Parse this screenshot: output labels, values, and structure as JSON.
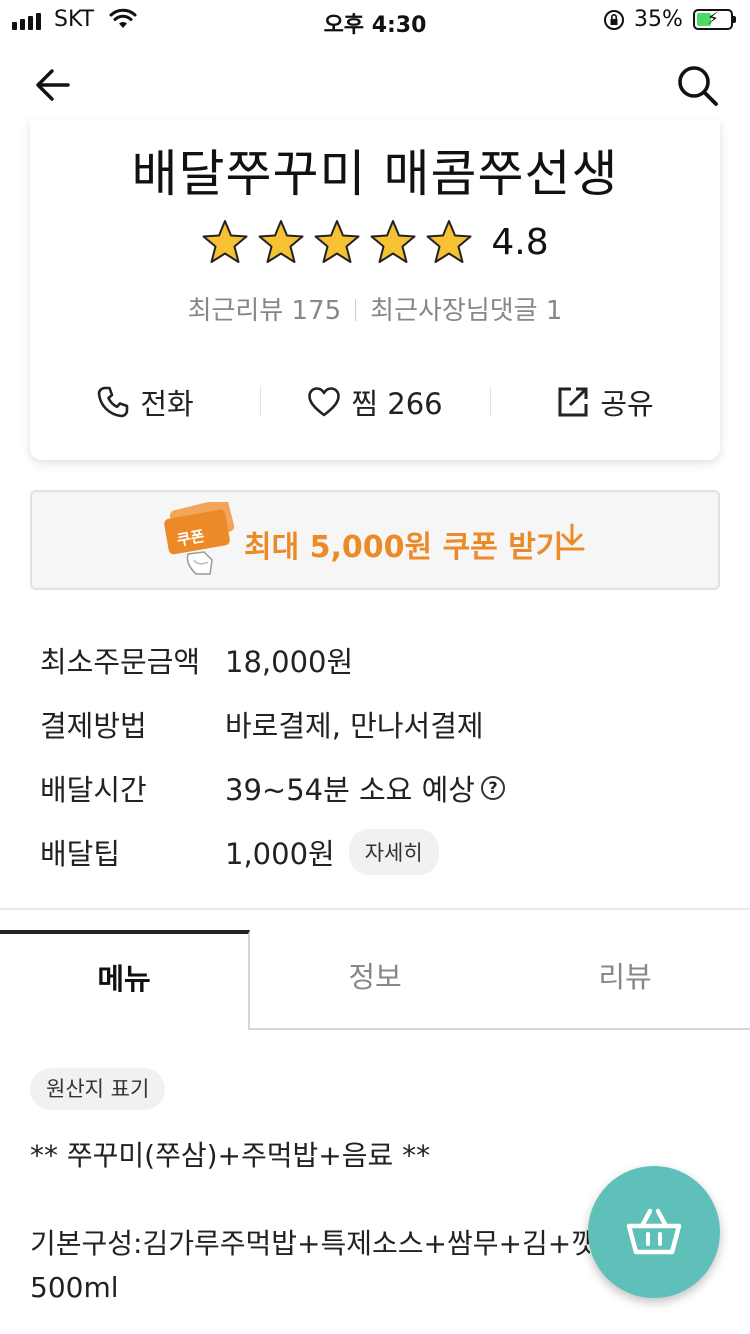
{
  "status_bar": {
    "carrier": "SKT",
    "time": "오후 4:30",
    "battery_percent": "35%",
    "battery_level": 0.35
  },
  "nav": {
    "back_icon": "arrow-left-icon",
    "search_icon": "search-icon"
  },
  "store": {
    "name": "배달쭈꾸미 매콤쭈선생",
    "rating": "4.8",
    "stars": 5,
    "recent_reviews": "최근리뷰 175",
    "owner_comments": "최근사장님댓글 1",
    "actions": {
      "call_label": "전화",
      "favorite_label": "찜 266",
      "share_label": "공유"
    }
  },
  "coupon": {
    "label": "최대 5,000원 쿠폰 받기",
    "ticket_text": "쿠폰",
    "accent": "#ed8a28"
  },
  "info": {
    "min_order_label": "최소주문금액",
    "min_order_value": "18,000원",
    "payment_label": "결제방법",
    "payment_value": "바로결제, 만나서결제",
    "delivery_time_label": "배달시간",
    "delivery_time_value": "39~54분 소요 예상",
    "delivery_tip_label": "배달팁",
    "delivery_tip_value": "1,000원",
    "detail_button": "자세히"
  },
  "tabs": {
    "menu": "메뉴",
    "info": "정보",
    "review": "리뷰",
    "active": "메뉴"
  },
  "menu": {
    "origin_chip": "원산지 표기",
    "title": "** 쭈꾸미(쭈삼)+주먹밥+음료 **",
    "description_line1": "기본구성:김가루주먹밥+특제소스+쌈무+김+깻",
    "description_line2": "500ml"
  },
  "cart": {
    "icon": "basket-icon",
    "color": "#5fbfb9"
  }
}
